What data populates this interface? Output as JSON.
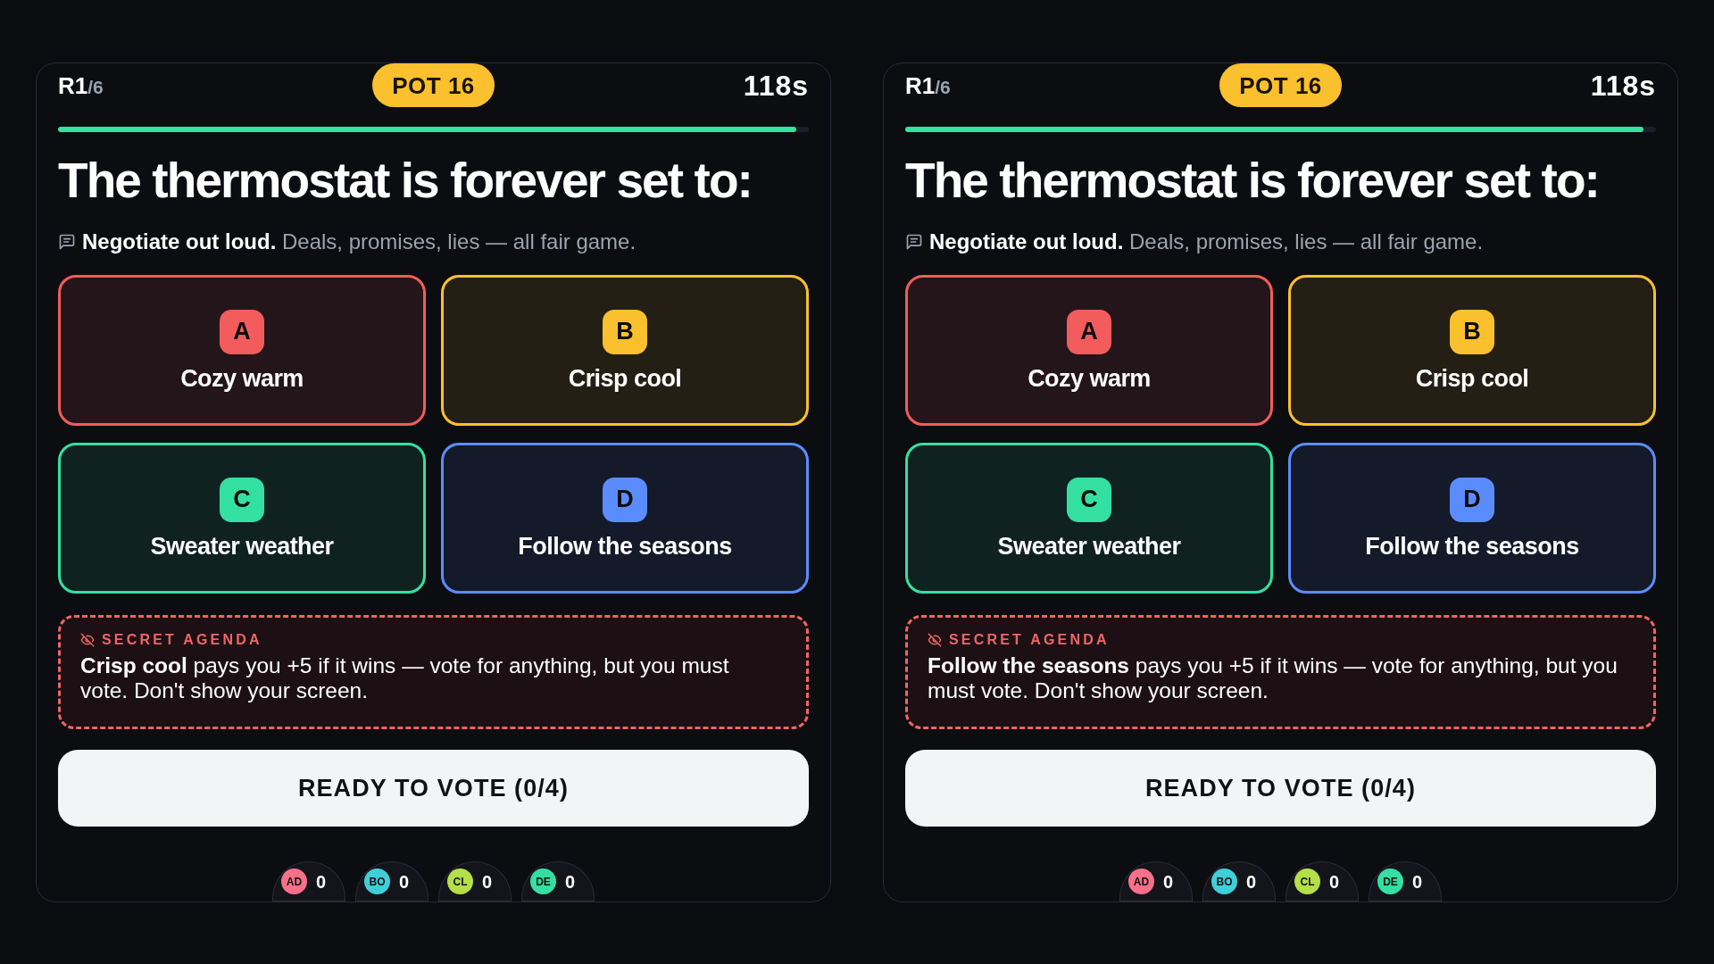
{
  "screens": [
    {
      "round": "R1",
      "round_total": "/6",
      "pot": "POT 16",
      "timer": "118s",
      "timer_bar": {
        "level": 0.983
      },
      "question": "The thermostat is forever set to:",
      "hint": "**Negotiate out loud.** Deals, promises, lies — all fair game.",
      "options": [
        {
          "letter": "A",
          "label": "Cozy warm",
          "color": "#f25c5c"
        },
        {
          "letter": "B",
          "label": "Crisp cool",
          "color": "#fbc02d"
        },
        {
          "letter": "C",
          "label": "Sweater weather",
          "color": "#34e0a1"
        },
        {
          "letter": "D",
          "label": "Follow the seasons",
          "color": "#5b8cff"
        }
      ],
      "secret_agenda": {
        "title": "SECRET AGENDA",
        "text": "**Crisp cool** pays you +5 if it wins — vote for anything, but you must vote. Don't show your screen."
      },
      "ready_button": "READY TO VOTE (0/4)",
      "players": [
        {
          "initials": "AD",
          "score": "0",
          "color": "#f7708a"
        },
        {
          "initials": "BO",
          "score": "0",
          "color": "#40cfd8"
        },
        {
          "initials": "CL",
          "score": "0",
          "color": "#b4df48"
        },
        {
          "initials": "DE",
          "score": "0",
          "color": "#34e0a1"
        }
      ]
    },
    {
      "round": "R1",
      "round_total": "/6",
      "pot": "POT 16",
      "timer": "118s",
      "timer_bar": {
        "level": 0.983
      },
      "question": "The thermostat is forever set to:",
      "hint": "**Negotiate out loud.** Deals, promises, lies — all fair game.",
      "options": [
        {
          "letter": "A",
          "label": "Cozy warm",
          "color": "#f25c5c"
        },
        {
          "letter": "B",
          "label": "Crisp cool",
          "color": "#fbc02d"
        },
        {
          "letter": "C",
          "label": "Sweater weather",
          "color": "#34e0a1"
        },
        {
          "letter": "D",
          "label": "Follow the seasons",
          "color": "#5b8cff"
        }
      ],
      "secret_agenda": {
        "title": "SECRET AGENDA",
        "text": "**Follow the seasons** pays you +5 if it wins — vote for anything, but you must vote. Don't show your screen."
      },
      "ready_button": "READY TO VOTE (0/4)",
      "players": [
        {
          "initials": "AD",
          "score": "0",
          "color": "#f7708a"
        },
        {
          "initials": "BO",
          "score": "0",
          "color": "#40cfd8"
        },
        {
          "initials": "CL",
          "score": "0",
          "color": "#b4df48"
        },
        {
          "initials": "DE",
          "score": "0",
          "color": "#34e0a1"
        }
      ]
    }
  ]
}
